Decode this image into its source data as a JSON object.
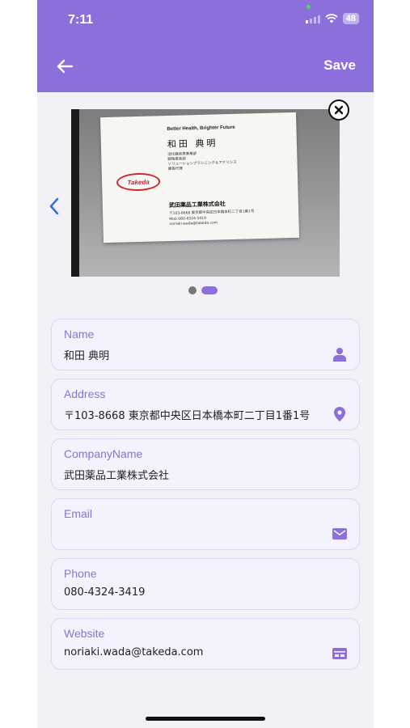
{
  "status_bar": {
    "time": "7:11",
    "battery": "48"
  },
  "header": {
    "back_icon": "arrow-left-icon",
    "save_label": "Save",
    "background": "#8c6fdb"
  },
  "card_image": {
    "tagline": "Better Health, Brighter Future",
    "name": "和田 典明",
    "department_lines": "消化器疾患事業部\n戦略推進部\nソリューションプランニング＆アナリシス\n課長代理",
    "logo_text": "Takeda",
    "company": "武田薬品工業株式会社",
    "address_lines": "〒103-8668 東京都中央区日本橋本町二丁目1番1号\nMob 080-4324-3419\nnoriaki.wada@takeda.com"
  },
  "carousel": {
    "page_count": 2,
    "active_index": 1
  },
  "fields": [
    {
      "label": "Name",
      "value": "和田 典明",
      "icon": "person-icon"
    },
    {
      "label": "Address",
      "value": "〒103-8668 東京都中央区日本橋本町二丁目1番1号",
      "icon": "location-pin-icon"
    },
    {
      "label": "CompanyName",
      "value": "武田薬品工業株式会社",
      "icon": ""
    },
    {
      "label": "Email",
      "value": "",
      "icon": "mail-icon"
    },
    {
      "label": "Phone",
      "value": "080-4324-3419",
      "icon": ""
    },
    {
      "label": "Website",
      "value": "noriaki.wada@takeda.com",
      "icon": "web-icon"
    }
  ]
}
